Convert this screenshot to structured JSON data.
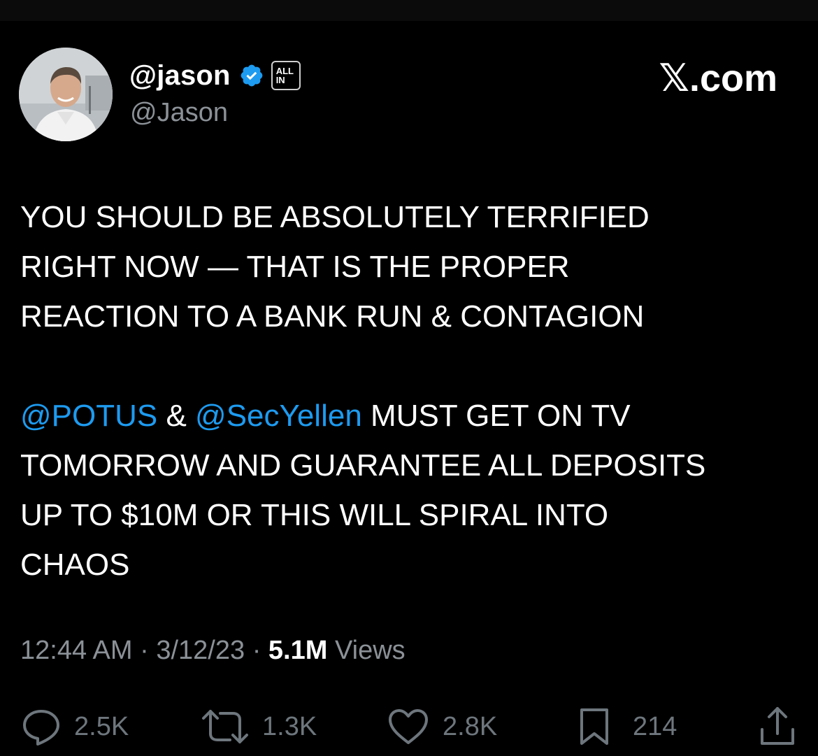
{
  "author": {
    "display_name": "@jason",
    "handle": "@Jason",
    "verified_icon": "verified-badge-icon",
    "affiliate_badge": {
      "line1": "ALL",
      "line2": "IN"
    }
  },
  "site_logo": "𝕏.com",
  "tweet": {
    "paragraph1": [
      "YOU SHOULD BE ABSOLUTELY TERRIFIED",
      "RIGHT NOW  — THAT IS THE PROPER",
      "REACTION TO A BANK RUN & CONTAGION"
    ],
    "paragraph2": {
      "mention1": "@POTUS",
      "connector": " & ",
      "mention2": "@SecYellen",
      "rest_line1": " MUST GET ON TV",
      "line2": "TOMORROW AND GUARANTEE ALL DEPOSITS",
      "line3": "UP TO $10M OR THIS WILL SPIRAL INTO",
      "line4": "CHAOS"
    }
  },
  "meta": {
    "time": "12:44 AM",
    "separator": " · ",
    "date": "3/12/23",
    "views_count": "5.1M",
    "views_label": " Views"
  },
  "actions": {
    "replies": "2.5K",
    "reposts": "1.3K",
    "likes": "2.8K",
    "bookmarks": "214"
  },
  "colors": {
    "background": "#000000",
    "text": "#ffffff",
    "secondary": "#8b9197",
    "mention": "#1d9bf0",
    "verified": "#1d9bf0"
  }
}
